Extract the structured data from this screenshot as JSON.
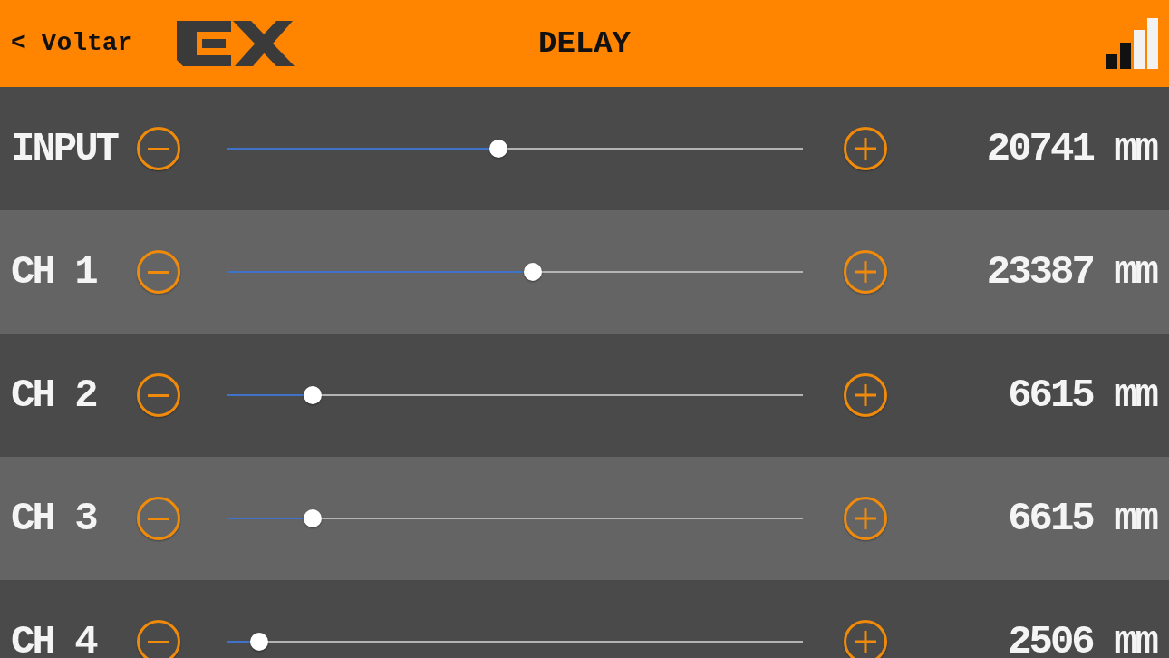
{
  "header": {
    "back_button": {
      "label": "< Voltar"
    },
    "title": "DELAY"
  },
  "channels": [
    {
      "name": "INPUT",
      "level": 0.471,
      "value": "20741 mm"
    },
    {
      "name": "CH 1",
      "level": 0.532,
      "value": "23387 mm"
    },
    {
      "name": "CH 2",
      "level": 0.15,
      "value": "6615 mm"
    },
    {
      "name": "CH 3",
      "level": 0.15,
      "value": "6615 mm"
    },
    {
      "name": "CH 4",
      "level": 0.057,
      "value": "2506 mm"
    }
  ]
}
